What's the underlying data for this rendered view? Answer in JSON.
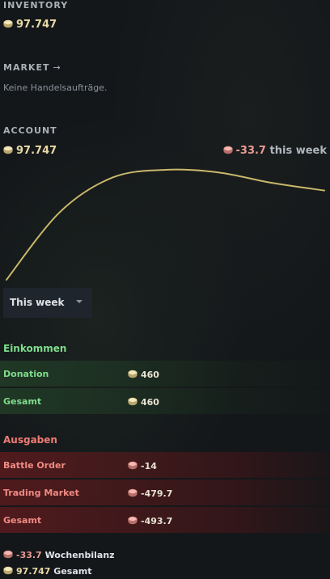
{
  "inventory": {
    "heading": "INVENTORY",
    "amount": "97.747"
  },
  "market": {
    "heading": "MARKET",
    "empty_text": "Keine Handelsaufträge."
  },
  "account": {
    "heading": "ACCOUNT",
    "amount": "97.747",
    "change_value": "-33.7",
    "change_suffix": "this week"
  },
  "chart_data": {
    "type": "line",
    "title": "",
    "xlabel": "",
    "ylabel": "",
    "grid": false,
    "series": [
      {
        "values": [
          0,
          52,
          79,
          85,
          83,
          75,
          69
        ]
      }
    ],
    "color": "#c9b86a"
  },
  "range_selector": {
    "selected": "This week"
  },
  "income": {
    "title": "Einkommen",
    "rows": [
      {
        "name": "Donation",
        "value": "460"
      },
      {
        "name": "Gesamt",
        "value": "460"
      }
    ]
  },
  "expenses": {
    "title": "Ausgaben",
    "rows": [
      {
        "name": "Battle Order",
        "value": "-14"
      },
      {
        "name": "Trading Market",
        "value": "-479.7"
      },
      {
        "name": "Gesamt",
        "value": "-493.7"
      }
    ]
  },
  "summary": {
    "weekly_value": "-33.7",
    "weekly_label": "Wochenbilanz",
    "total_value": "97.747",
    "total_label": "Gesamt"
  },
  "colors": {
    "coin_gold": "#e8d9a6",
    "coin_red": "#e99a94",
    "income_green": "#7fdc8c",
    "expense_red": "#f07b74",
    "line_gold": "#c9b86a"
  }
}
